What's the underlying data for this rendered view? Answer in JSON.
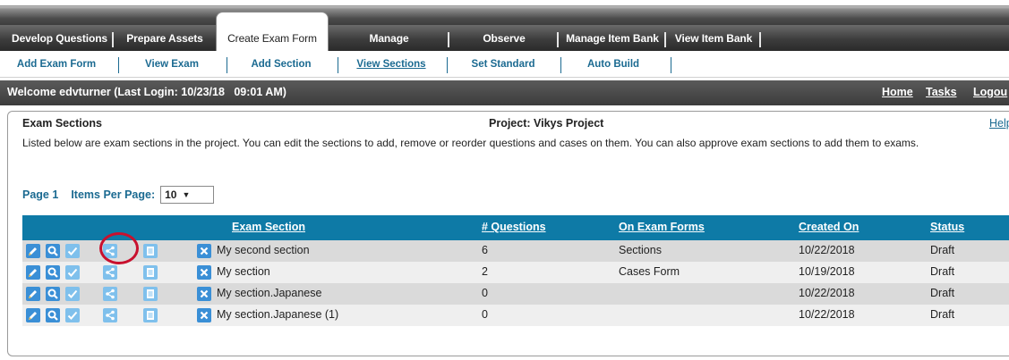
{
  "topnav": {
    "tabs": [
      {
        "label": "Develop Questions"
      },
      {
        "label": "Prepare Assets"
      },
      {
        "label": "Create Exam Form",
        "active": true
      },
      {
        "label": "Manage"
      },
      {
        "label": "Observe"
      },
      {
        "label": "Manage Item Bank"
      },
      {
        "label": "View Item Bank"
      }
    ]
  },
  "subnav": {
    "items": [
      {
        "label": "Add Exam Form"
      },
      {
        "label": "View Exam"
      },
      {
        "label": "Add Section"
      },
      {
        "label": "View Sections",
        "active": true
      },
      {
        "label": "Set Standard"
      },
      {
        "label": "Auto Build"
      }
    ]
  },
  "welcome": {
    "text": "Welcome edvturner (Last Login: 10/23/18   09:01 AM)",
    "links": {
      "home": "Home",
      "tasks": "Tasks",
      "logout": "Logou"
    }
  },
  "panel": {
    "title": "Exam Sections",
    "project": "Project: Vikys Project",
    "help": "Help",
    "description": "Listed below are exam sections in the project. You can edit the sections to add, remove or reorder questions and cases on them. You can also approve exam sections to add them to exams."
  },
  "pager": {
    "page": "Page 1",
    "items_per_page_label": "Items Per Page:",
    "items_per_page_value": "10"
  },
  "table": {
    "columns": [
      "Exam Section",
      "# Questions",
      "On Exam Forms",
      "Created On",
      "Status"
    ],
    "rows": [
      {
        "section": "My second section",
        "questions": "6",
        "forms": "Sections",
        "created": "10/22/2018",
        "status": "Draft"
      },
      {
        "section": "My section",
        "questions": "2",
        "forms": "Cases Form",
        "created": "10/19/2018",
        "status": "Draft"
      },
      {
        "section": "My section.Japanese",
        "questions": "0",
        "forms": "",
        "created": "10/22/2018",
        "status": "Draft"
      },
      {
        "section": "My section.Japanese (1)",
        "questions": "0",
        "forms": "",
        "created": "10/22/2018",
        "status": "Draft"
      }
    ]
  },
  "colors": {
    "accent": "#0e7aa6",
    "link": "#1b6a91",
    "highlight": "#c8102e",
    "icon_blue": "#3a8fd6",
    "icon_light": "#7fc0ec"
  },
  "row_icons": [
    "edit-icon",
    "search-icon",
    "approve-icon",
    "share-icon",
    "document-icon",
    "delete-icon"
  ]
}
